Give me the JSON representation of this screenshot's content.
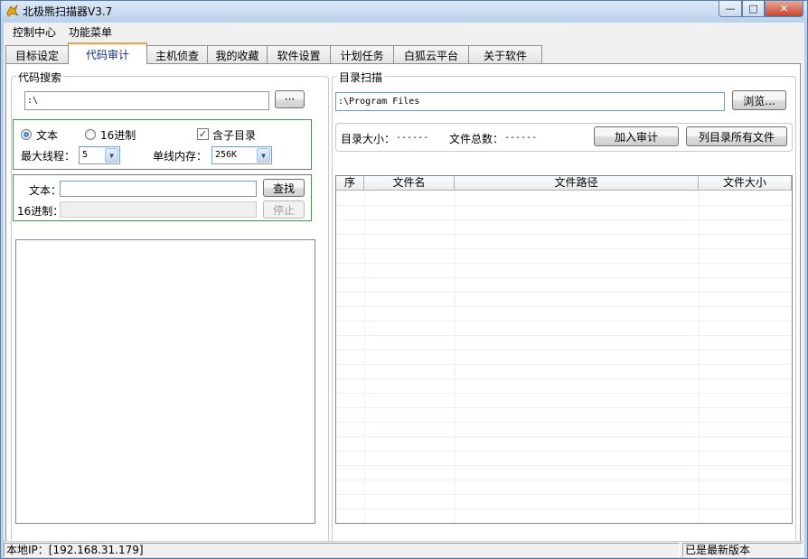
{
  "window": {
    "title": "北极熊扫描器V3.7",
    "icon": "bear-app-icon",
    "buttons": {
      "minimize": "—",
      "maximize": "□",
      "close": "✕"
    }
  },
  "menubar": {
    "items": [
      "控制中心",
      "功能菜单"
    ]
  },
  "tabs": [
    {
      "label": "目标设定"
    },
    {
      "label": "代码审计",
      "active": true
    },
    {
      "label": "主机侦查"
    },
    {
      "label": "我的收藏"
    },
    {
      "label": "软件设置"
    },
    {
      "label": "计划任务"
    },
    {
      "label": "白狐云平台"
    },
    {
      "label": "关于软件"
    }
  ],
  "code_search": {
    "group_label": "代码搜索",
    "path_value": ":\\",
    "browse_label": "···",
    "mode_text_label": "文本",
    "mode_hex_label": "16进制",
    "mode_selected": "文本",
    "include_subdirs_label": "含子目录",
    "include_subdirs_checked": true,
    "check_mark": "✓",
    "max_threads_label": "最大线程：",
    "max_threads_value": "5",
    "thread_mem_label": "单线内存：",
    "thread_mem_value": "256K",
    "text_label": "文本：",
    "text_value": "",
    "hex_label": "16进制：",
    "hex_value": "",
    "find_label": "查找",
    "stop_label": "停止"
  },
  "dir_scan": {
    "group_label": "目录扫描",
    "path_value": ":\\Program Files",
    "browse_label": "浏览...",
    "dir_size_label": "目录大小：",
    "dir_size_value": "------",
    "file_count_label": "文件总数：",
    "file_count_value": "------",
    "add_audit_label": "加入审计",
    "list_all_label": "列目录所有文件",
    "columns": [
      "序",
      "文件名",
      "文件路径",
      "文件大小"
    ],
    "rows": []
  },
  "statusbar": {
    "local_ip": "本地IP：[192.168.31.179]",
    "version_status": "已是最新版本"
  }
}
